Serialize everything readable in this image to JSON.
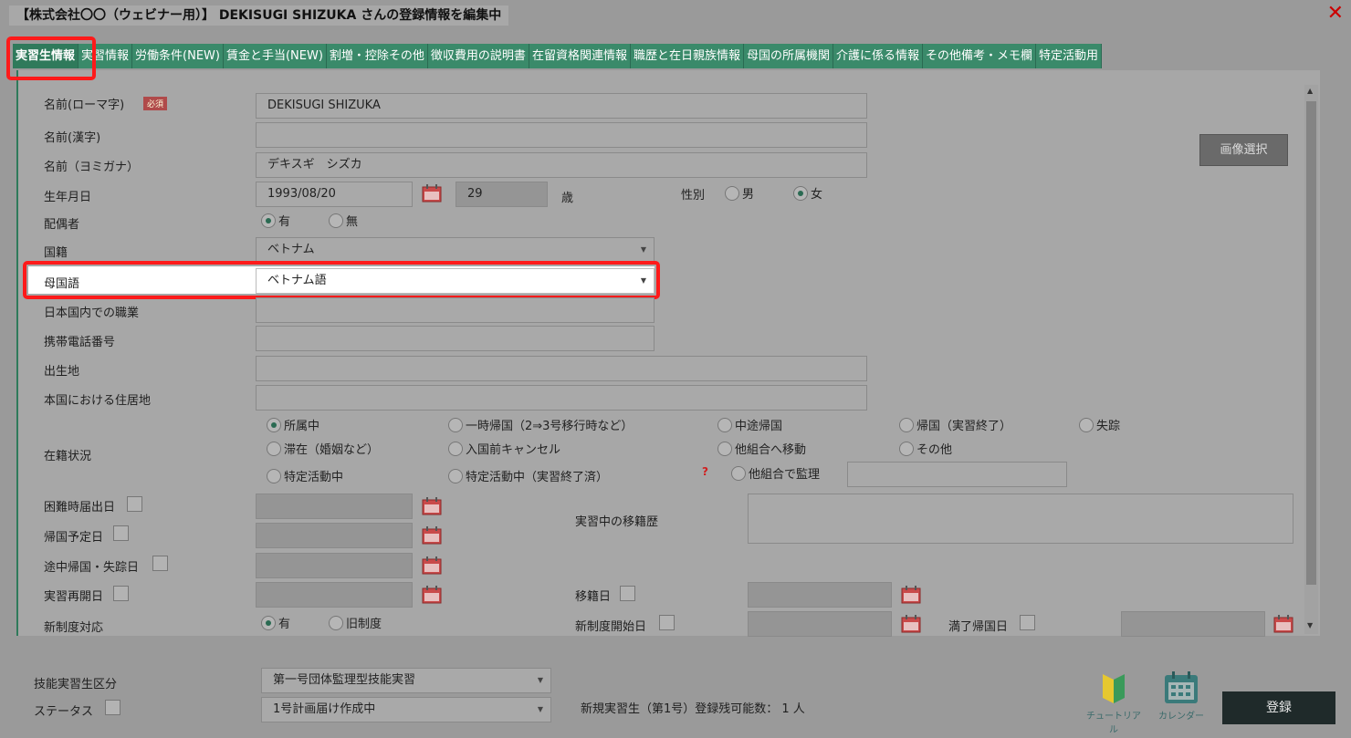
{
  "window": {
    "title": "【株式会社〇〇（ウェビナー用）】 DEKISUGI SHIZUKA さんの登録情報を編集中"
  },
  "tabs": [
    "実習生情報",
    "実習情報",
    "労働条件(NEW)",
    "賃金と手当(NEW)",
    "割増・控除その他",
    "徴収費用の説明書",
    "在留資格関連情報",
    "職歴と在日親族情報",
    "母国の所属機関",
    "介護に係る情報",
    "その他備考・メモ欄",
    "特定活動用"
  ],
  "form": {
    "name_roman_label": "名前(ローマ字)",
    "required_badge": "必須",
    "name_roman_value": "DEKISUGI SHIZUKA",
    "name_kanji_label": "名前(漢字)",
    "name_kana_label": "名前（ヨミガナ）",
    "name_kana_value": "デキスギ　シズカ",
    "birthday_label": "生年月日",
    "birthday_value": "1993/08/20",
    "age_value": "29",
    "age_unit": "歳",
    "gender_label": "性別",
    "gender_male": "男",
    "gender_female": "女",
    "spouse_label": "配偶者",
    "spouse_yes": "有",
    "spouse_no": "無",
    "nationality_label": "国籍",
    "nationality_value": "ベトナム",
    "native_language_label": "母国語",
    "native_language_value": "ベトナム語",
    "occupation_label": "日本国内での職業",
    "mobile_label": "携帯電話番号",
    "birthplace_label": "出生地",
    "home_address_label": "本国における住居地",
    "status_label": "在籍状況",
    "status_options": [
      "所属中",
      "一時帰国（2⇒3号移行時など）",
      "中途帰国",
      "帰国（実習終了）",
      "失踪",
      "滞在（婚姻など）",
      "入国前キャンセル",
      "他組合へ移動",
      "その他",
      "特定活動中",
      "特定活動中（実習終了済）",
      "他組合で監理"
    ],
    "help_mark": "?",
    "hardship_date_label": "困難時届出日",
    "return_plan_label": "帰国予定日",
    "midway_return_label": "途中帰国・失踪日",
    "resume_label": "実習再開日",
    "transfer_history_label": "実習中の移籍歴",
    "transfer_date_label": "移籍日",
    "new_system_label": "新制度対応",
    "new_system_yes": "有",
    "new_system_old": "旧制度",
    "new_system_start_label": "新制度開始日",
    "completion_return_label": "満了帰国日",
    "image_select_button": "画像選択"
  },
  "footer": {
    "category_label": "技能実習生区分",
    "category_value": "第一号団体監理型技能実習",
    "status_label": "ステータス",
    "status_value": "1号計画届け作成中",
    "remaining_text": "新規実習生（第1号）登録残可能数： 1 人",
    "tutorial_label": "チュートリアル",
    "calendar_label": "カレンダー",
    "register_button": "登録"
  }
}
